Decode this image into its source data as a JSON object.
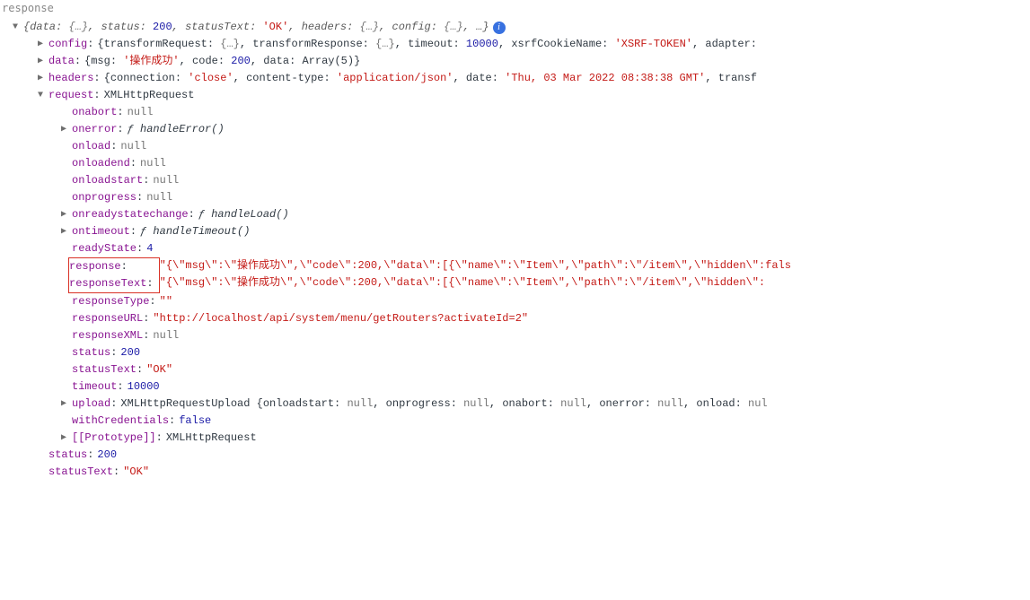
{
  "title": "response",
  "summary": {
    "prefix": "{",
    "parts": [
      {
        "k": "data",
        "v": "{…}",
        "t": "grey"
      },
      {
        "k": "status",
        "v": "200",
        "t": "blue"
      },
      {
        "k": "statusText",
        "v": "'OK'",
        "t": "red"
      },
      {
        "k": "headers",
        "v": "{…}",
        "t": "grey"
      },
      {
        "k": "config",
        "v": "{…}",
        "t": "grey"
      }
    ],
    "suffix": ", …}"
  },
  "config": {
    "key": "config",
    "parts": [
      {
        "txt": "{transformRequest: ",
        "t": "dark"
      },
      {
        "txt": "{…}",
        "t": "grey"
      },
      {
        "txt": ", transformResponse: ",
        "t": "dark"
      },
      {
        "txt": "{…}",
        "t": "grey"
      },
      {
        "txt": ", timeout: ",
        "t": "dark"
      },
      {
        "txt": "10000",
        "t": "blue"
      },
      {
        "txt": ", xsrfCookieName: ",
        "t": "dark"
      },
      {
        "txt": "'XSRF-TOKEN'",
        "t": "red"
      },
      {
        "txt": ", adapter:",
        "t": "dark"
      }
    ]
  },
  "data": {
    "key": "data",
    "parts": [
      {
        "txt": "{msg: ",
        "t": "dark"
      },
      {
        "txt": "'操作成功'",
        "t": "red"
      },
      {
        "txt": ", code: ",
        "t": "dark"
      },
      {
        "txt": "200",
        "t": "blue"
      },
      {
        "txt": ", data: ",
        "t": "dark"
      },
      {
        "txt": "Array(5)",
        "t": "dark"
      },
      {
        "txt": "}",
        "t": "dark"
      }
    ]
  },
  "headers": {
    "key": "headers",
    "parts": [
      {
        "txt": "{connection: ",
        "t": "dark"
      },
      {
        "txt": "'close'",
        "t": "red"
      },
      {
        "txt": ", content-type: ",
        "t": "dark"
      },
      {
        "txt": "'application/json'",
        "t": "red"
      },
      {
        "txt": ", date: ",
        "t": "dark"
      },
      {
        "txt": "'Thu, 03 Mar 2022 08:38:38 GMT'",
        "t": "red"
      },
      {
        "txt": ", transf",
        "t": "dark"
      }
    ]
  },
  "request": {
    "key": "request",
    "value": "XMLHttpRequest",
    "children": [
      {
        "k": "onabort",
        "v": "null",
        "t": "grey",
        "arrow": false
      },
      {
        "k": "onerror",
        "v": "ƒ handleError()",
        "t": "ital",
        "arrow": true
      },
      {
        "k": "onload",
        "v": "null",
        "t": "grey",
        "arrow": false
      },
      {
        "k": "onloadend",
        "v": "null",
        "t": "grey",
        "arrow": false
      },
      {
        "k": "onloadstart",
        "v": "null",
        "t": "grey",
        "arrow": false
      },
      {
        "k": "onprogress",
        "v": "null",
        "t": "grey",
        "arrow": false
      },
      {
        "k": "onreadystatechange",
        "v": "ƒ handleLoad()",
        "t": "ital",
        "arrow": true
      },
      {
        "k": "ontimeout",
        "v": "ƒ handleTimeout()",
        "t": "ital",
        "arrow": true
      },
      {
        "k": "readyState",
        "v": "4",
        "t": "blue",
        "arrow": false
      },
      {
        "k": "response",
        "v": "\"{\\\"msg\\\":\\\"操作成功\\\",\\\"code\\\":200,\\\"data\\\":[{\\\"name\\\":\\\"Item\\\",\\\"path\\\":\\\"/item\\\",\\\"hidden\\\":fals",
        "t": "red",
        "arrow": false,
        "boxed": true
      },
      {
        "k": "responseText",
        "v": "\"{\\\"msg\\\":\\\"操作成功\\\",\\\"code\\\":200,\\\"data\\\":[{\\\"name\\\":\\\"Item\\\",\\\"path\\\":\\\"/item\\\",\\\"hidden\\\":",
        "t": "red",
        "arrow": false,
        "boxed": true
      },
      {
        "k": "responseType",
        "v": "\"\"",
        "t": "red",
        "arrow": false
      },
      {
        "k": "responseURL",
        "v": "\"http://localhost/api/system/menu/getRouters?activateId=2\"",
        "t": "red",
        "arrow": false
      },
      {
        "k": "responseXML",
        "v": "null",
        "t": "grey",
        "arrow": false
      },
      {
        "k": "status",
        "v": "200",
        "t": "blue",
        "arrow": false
      },
      {
        "k": "statusText",
        "v": "\"OK\"",
        "t": "red",
        "arrow": false
      },
      {
        "k": "timeout",
        "v": "10000",
        "t": "blue",
        "arrow": false
      }
    ]
  },
  "upload": {
    "key": "upload",
    "parts": [
      {
        "txt": "XMLHttpRequestUpload {onloadstart: ",
        "t": "dark"
      },
      {
        "txt": "null",
        "t": "grey"
      },
      {
        "txt": ", onprogress: ",
        "t": "dark"
      },
      {
        "txt": "null",
        "t": "grey"
      },
      {
        "txt": ", onabort: ",
        "t": "dark"
      },
      {
        "txt": "null",
        "t": "grey"
      },
      {
        "txt": ", onerror: ",
        "t": "dark"
      },
      {
        "txt": "null",
        "t": "grey"
      },
      {
        "txt": ", onload: ",
        "t": "dark"
      },
      {
        "txt": "nul",
        "t": "grey"
      }
    ]
  },
  "withCredentials": {
    "key": "withCredentials",
    "v": "false",
    "t": "blue"
  },
  "prototype": {
    "key": "[[Prototype]]",
    "v": "XMLHttpRequest"
  },
  "tail": [
    {
      "k": "status",
      "v": "200",
      "t": "blue"
    },
    {
      "k": "statusText",
      "v": "\"OK\"",
      "t": "red"
    }
  ],
  "info_glyph": "i"
}
